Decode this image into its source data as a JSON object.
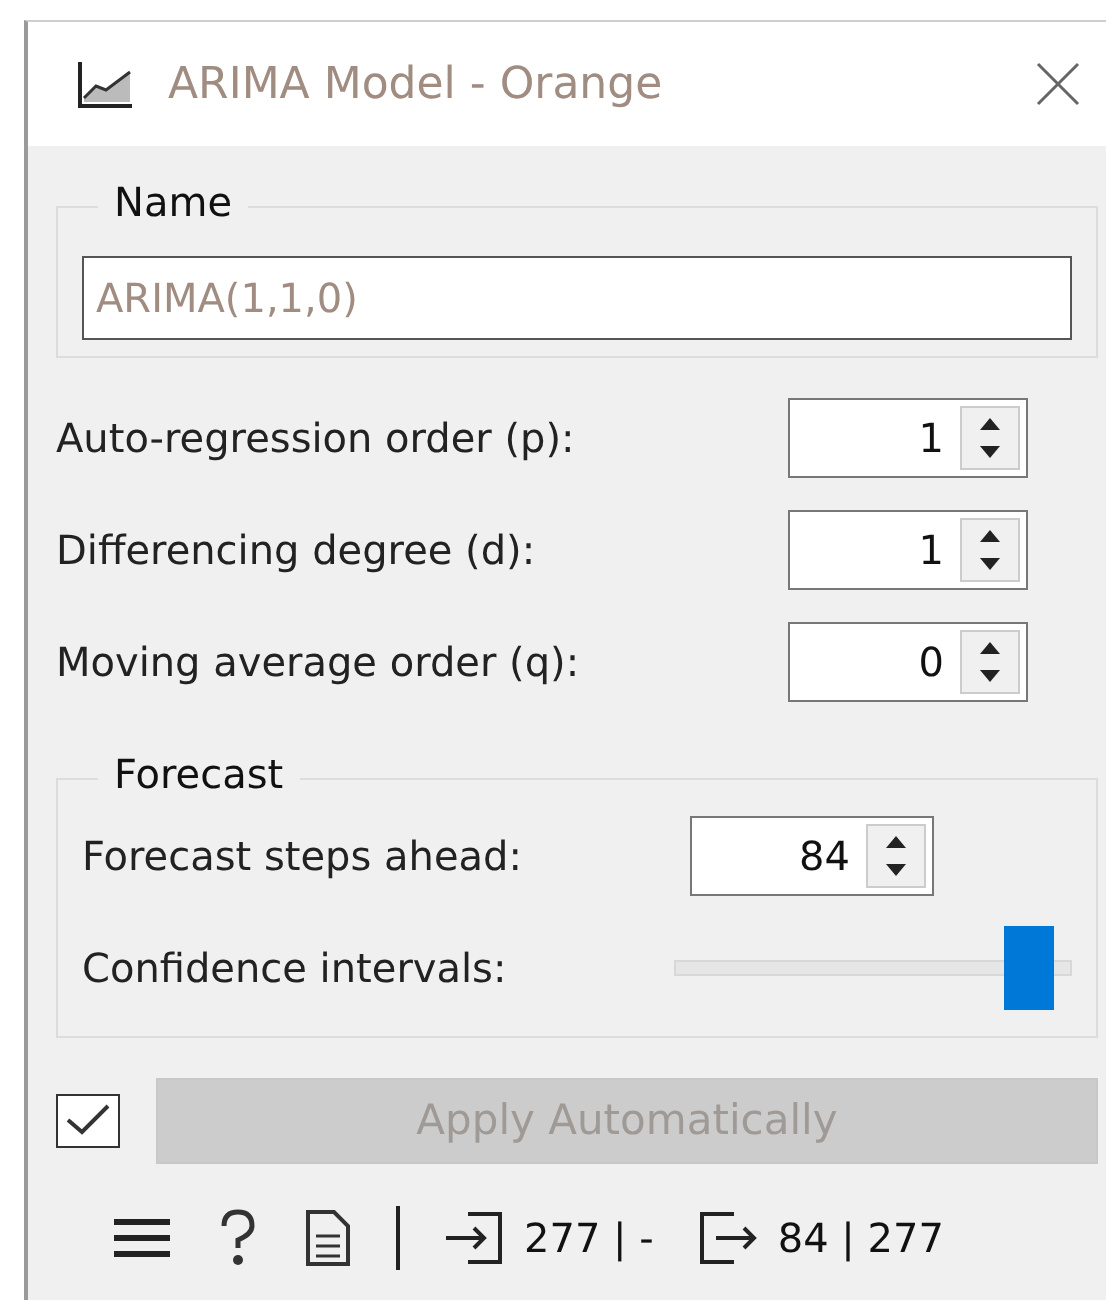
{
  "window": {
    "title": "ARIMA Model - Orange"
  },
  "name_group": {
    "title": "Name",
    "placeholder": "ARIMA(1,1,0)"
  },
  "parameters": [
    {
      "label": "Auto-regression order (p):",
      "value": "1"
    },
    {
      "label": "Differencing degree (d):",
      "value": "1"
    },
    {
      "label": "Moving average order (q):",
      "value": "0"
    }
  ],
  "forecast": {
    "title": "Forecast",
    "steps_label": "Forecast steps ahead:",
    "steps_value": "84",
    "confidence_label": "Confidence intervals:",
    "confidence_level": {
      "level": 0.95
    }
  },
  "apply": {
    "checked": true,
    "label": "Apply Automatically",
    "disabled": true
  },
  "status_bar": {
    "input": "277 | -",
    "output": "84 | 277"
  }
}
